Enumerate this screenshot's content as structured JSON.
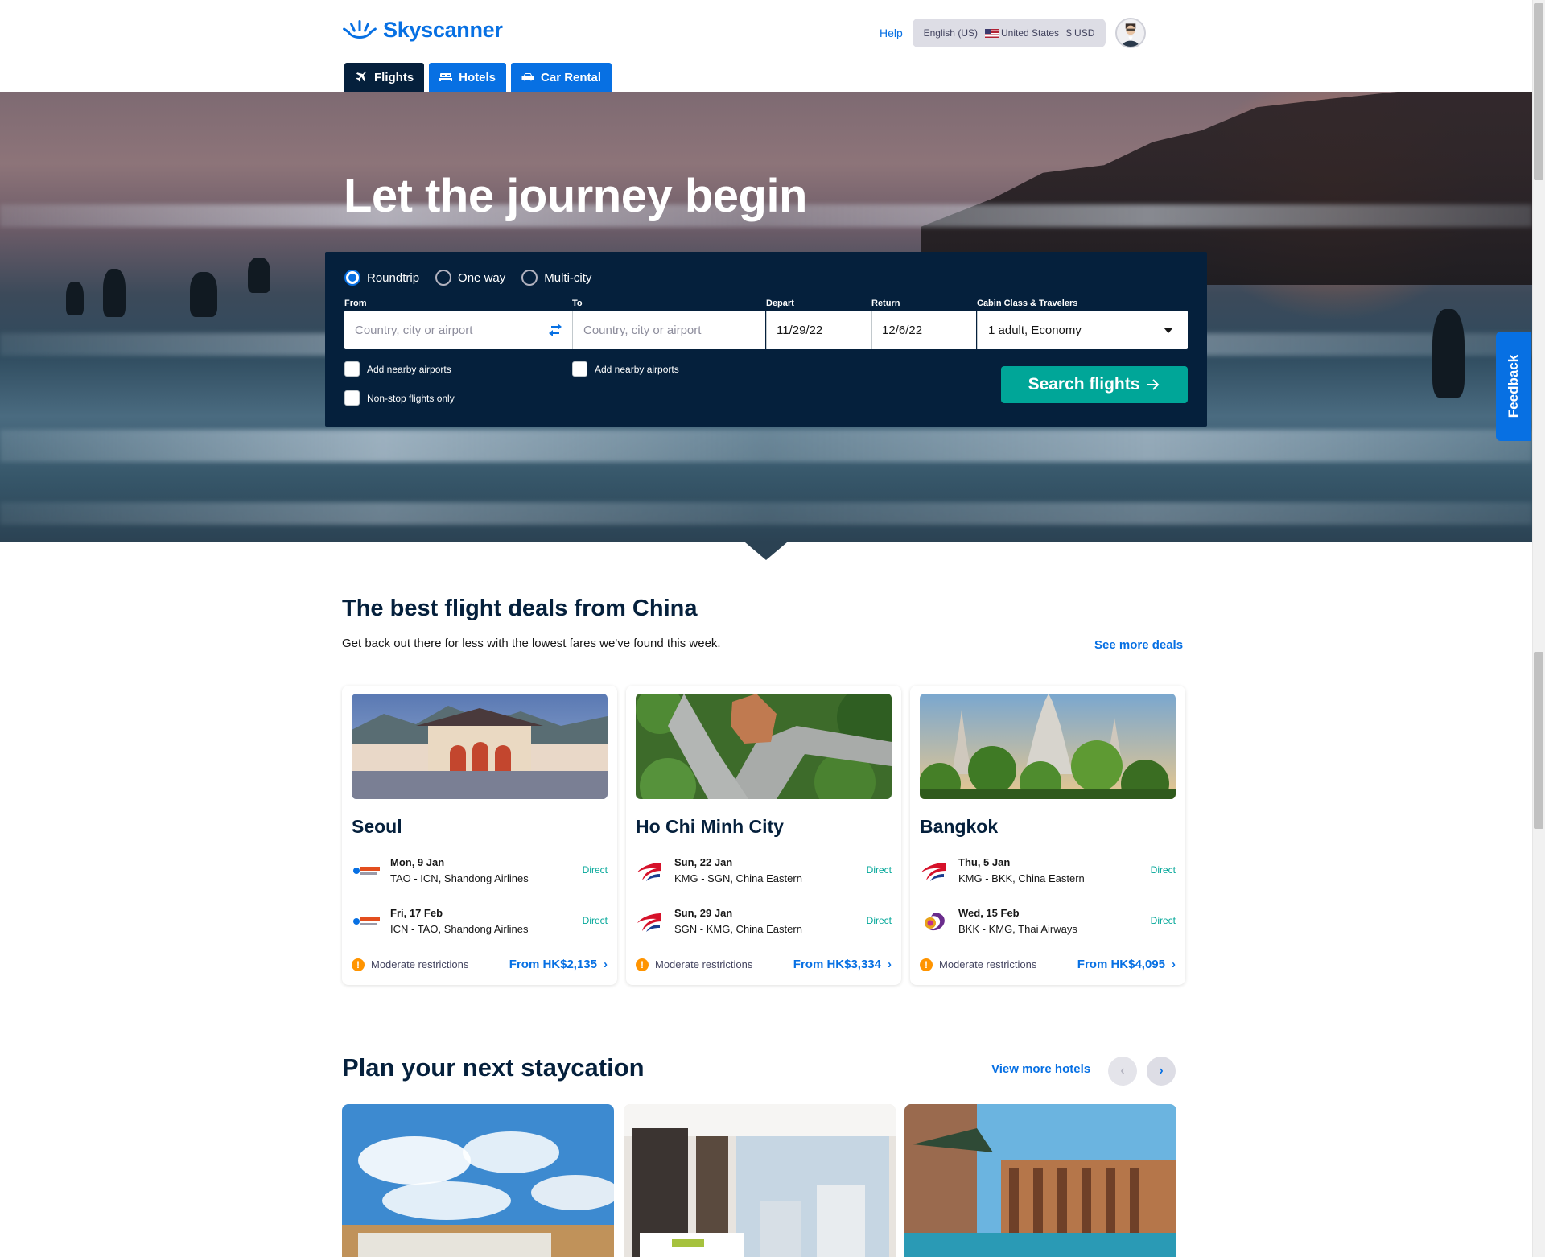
{
  "header": {
    "brand": "Skyscanner",
    "help": "Help",
    "language": "English (US)",
    "country": "United States",
    "currency": "$ USD",
    "tabs": [
      {
        "label": "Flights",
        "icon": "plane-icon",
        "active": true
      },
      {
        "label": "Hotels",
        "icon": "bed-icon",
        "active": false
      },
      {
        "label": "Car Rental",
        "icon": "car-icon",
        "active": false
      }
    ]
  },
  "hero": {
    "title": "Let the journey begin"
  },
  "search": {
    "trip_types": [
      "Roundtrip",
      "One way",
      "Multi-city"
    ],
    "selected_trip_type": "Roundtrip",
    "from_label": "From",
    "from_placeholder": "Country, city or airport",
    "to_label": "To",
    "to_placeholder": "Country, city or airport",
    "depart_label": "Depart",
    "depart_value": "11/29/22",
    "return_label": "Return",
    "return_value": "12/6/22",
    "cabin_label": "Cabin Class & Travelers",
    "cabin_value": "1 adult, Economy",
    "nearby_from": "Add nearby airports",
    "nearby_to": "Add nearby airports",
    "nonstop": "Non-stop flights only",
    "button": "Search flights"
  },
  "feedback": "Feedback",
  "deals": {
    "title": "The best flight deals from China",
    "subtitle": "Get back out there for less with the lowest fares we've found this week.",
    "see_more": "See more deals",
    "cards": [
      {
        "city": "Seoul",
        "legs": [
          {
            "date": "Mon, 9 Jan",
            "route": "TAO - ICN, Shandong Airlines",
            "type": "Direct",
            "airline_icon": "shandong-airlines-logo-icon"
          },
          {
            "date": "Fri, 17 Feb",
            "route": "ICN - TAO, Shandong Airlines",
            "type": "Direct",
            "airline_icon": "shandong-airlines-logo-icon"
          }
        ],
        "restrictions": "Moderate restrictions",
        "price": "From HK$2,135"
      },
      {
        "city": "Ho Chi Minh City",
        "legs": [
          {
            "date": "Sun, 22 Jan",
            "route": "KMG - SGN, China Eastern",
            "type": "Direct",
            "airline_icon": "china-eastern-logo-icon"
          },
          {
            "date": "Sun, 29 Jan",
            "route": "SGN - KMG, China Eastern",
            "type": "Direct",
            "airline_icon": "china-eastern-logo-icon"
          }
        ],
        "restrictions": "Moderate restrictions",
        "price": "From HK$3,334"
      },
      {
        "city": "Bangkok",
        "legs": [
          {
            "date": "Thu, 5 Jan",
            "route": "KMG - BKK, China Eastern",
            "type": "Direct",
            "airline_icon": "china-eastern-logo-icon"
          },
          {
            "date": "Wed, 15 Feb",
            "route": "BKK - KMG, Thai Airways",
            "type": "Direct",
            "airline_icon": "thai-airways-logo-icon"
          }
        ],
        "restrictions": "Moderate restrictions",
        "price": "From HK$4,095"
      }
    ]
  },
  "staycation": {
    "title": "Plan your next staycation",
    "view_more": "View more hotels"
  },
  "colors": {
    "brand_blue": "#0770e3",
    "navy": "#05203c",
    "teal": "#00a698",
    "warning": "#ff9400",
    "china_eastern_red": "#d6112a",
    "china_eastern_blue": "#1b3d8f"
  }
}
